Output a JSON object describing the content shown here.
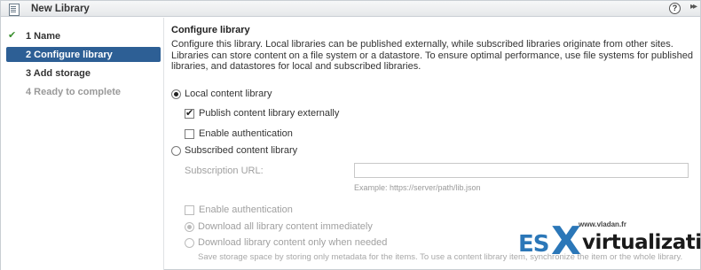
{
  "window": {
    "title": "New Library",
    "help_label": "?",
    "expand_label": "▸▸"
  },
  "nav": {
    "steps": [
      {
        "label": "1  Name",
        "state": "done"
      },
      {
        "label": "2  Configure library",
        "state": "active"
      },
      {
        "label": "3  Add storage",
        "state": "normal"
      },
      {
        "label": "4  Ready to complete",
        "state": "disabled"
      }
    ]
  },
  "main": {
    "title": "Configure library",
    "description": "Configure this library. Local libraries can be published externally, while subscribed libraries originate from other sites. Libraries can store content on a file system or a datastore. To ensure optimal performance, use file systems for published libraries, and datastores for local and subscribed libraries.",
    "local_label": "Local content library",
    "publish_label": "Publish content library externally",
    "enable_auth_label": "Enable authentication",
    "subscribed_label": "Subscribed content library",
    "subscription_url_label": "Subscription URL:",
    "subscription_url_value": "",
    "example_text": "Example: https://server/path/lib.json",
    "sub_enable_auth_label": "Enable authentication",
    "download_all_label": "Download all library content immediately",
    "download_needed_label": "Download library content only when needed",
    "hint_text": "Save storage space by storing only metadata for the items. To use a content library item, synchronize the item or the whole library."
  },
  "watermark": {
    "site": "www.vladan.fr",
    "es": "ES",
    "x": "X",
    "virt": "virtualization"
  },
  "colors": {
    "accent": "#2d5f95",
    "check": "#3a8f2e",
    "logo_blue": "#2b77b8"
  }
}
